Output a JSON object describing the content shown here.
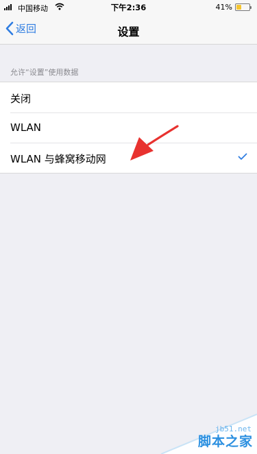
{
  "status_bar": {
    "carrier": "中国移动",
    "time": "下午2:36",
    "battery_percent": "41%",
    "battery_level": 0.41,
    "battery_color": "#f5c530"
  },
  "nav": {
    "back_label": "返回",
    "title": "设置"
  },
  "section": {
    "header": "允许“设置”使用数据"
  },
  "options": [
    {
      "label": "关闭",
      "selected": false
    },
    {
      "label": "WLAN",
      "selected": false
    },
    {
      "label": "WLAN 与蜂窝移动网",
      "selected": true
    }
  ],
  "colors": {
    "accent": "#2f7de1",
    "annotation_arrow": "#e8322f",
    "background": "#efeff4"
  },
  "icons": {
    "back": "chevron-left-icon",
    "check": "checkmark-icon",
    "signal": "cellular-signal-icon",
    "wifi": "wifi-icon",
    "battery": "battery-icon",
    "arrow": "annotation-arrow"
  },
  "watermark": {
    "url": "jb51.net",
    "text": "脚本之家"
  }
}
